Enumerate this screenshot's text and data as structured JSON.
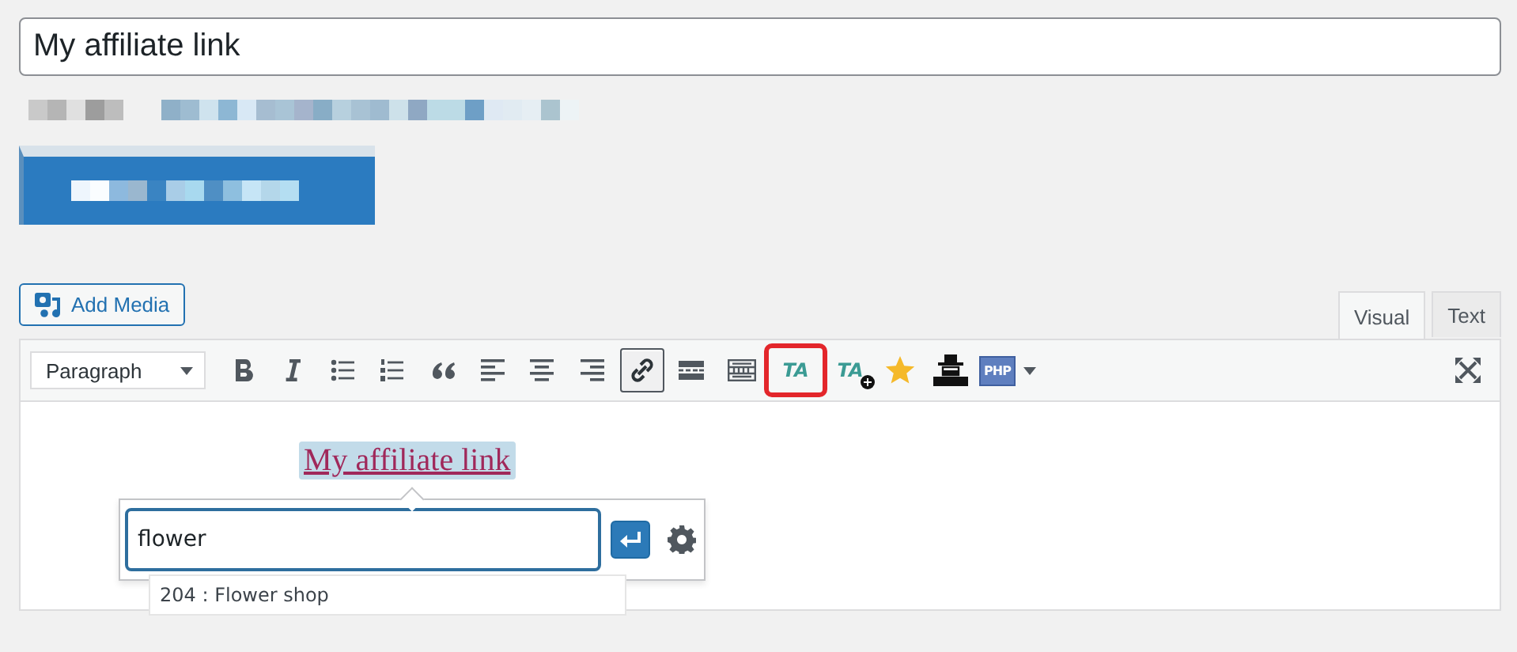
{
  "title_field": {
    "value": "My affiliate link"
  },
  "add_media": {
    "label": "Add Media"
  },
  "editor_tabs": [
    {
      "label": "Visual",
      "selected": true
    },
    {
      "label": "Text",
      "selected": false
    }
  ],
  "toolbar": {
    "format": {
      "value": "Paragraph"
    },
    "buttons": [
      {
        "kind": "bold",
        "active": false,
        "highlighted": false
      },
      {
        "kind": "italic",
        "active": false,
        "highlighted": false
      },
      {
        "kind": "bullet-list",
        "active": false,
        "highlighted": false
      },
      {
        "kind": "numbered-list",
        "active": false,
        "highlighted": false
      },
      {
        "kind": "blockquote",
        "active": false,
        "highlighted": false
      },
      {
        "kind": "align-left",
        "active": false,
        "highlighted": false
      },
      {
        "kind": "align-center",
        "active": false,
        "highlighted": false
      },
      {
        "kind": "align-right",
        "active": false,
        "highlighted": false
      },
      {
        "kind": "link",
        "active": true,
        "highlighted": false
      },
      {
        "kind": "read-more",
        "active": false,
        "highlighted": false
      },
      {
        "kind": "toolbar-toggle",
        "active": false,
        "highlighted": false
      },
      {
        "kind": "ta-link",
        "label": "TA",
        "active": false,
        "highlighted": true
      },
      {
        "kind": "ta-add",
        "label": "TA",
        "active": false,
        "highlighted": false
      },
      {
        "kind": "star",
        "active": false,
        "highlighted": false
      },
      {
        "kind": "figure",
        "active": false,
        "highlighted": false
      },
      {
        "kind": "php",
        "label": "PHP",
        "active": false,
        "highlighted": false
      },
      {
        "kind": "fullscreen",
        "active": false,
        "highlighted": false
      }
    ]
  },
  "content": {
    "link_text": "My affiliate link",
    "link_selected": true
  },
  "link_popup": {
    "value": "flower",
    "suggestions": [
      "204 : Flower shop"
    ]
  }
}
